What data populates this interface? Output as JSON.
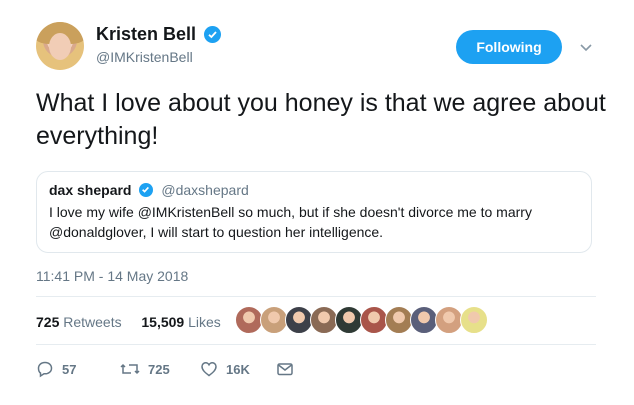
{
  "user": {
    "name": "Kristen Bell",
    "handle": "@IMKristenBell",
    "follow_label": "Following"
  },
  "tweet": {
    "text": "What I love about you honey is that we agree about everything!"
  },
  "quoted_tweet": {
    "name": "dax shepard",
    "handle": "@daxshepard",
    "text": "I love my wife @IMKristenBell so much, but if she doesn't divorce me to marry @donaldglover, I will start to question her intelligence."
  },
  "timestamp": "11:41 PM - 14 May 2018",
  "stats": {
    "retweets_count": "725",
    "retweets_label": "Retweets",
    "likes_count": "15,509",
    "likes_label": "Likes"
  },
  "actions": {
    "replies": "57",
    "retweets": "725",
    "likes": "16K"
  },
  "colors": {
    "accent": "#1da1f2",
    "muted": "#657786",
    "border": "#e1e8ed"
  },
  "liker_avatar_colors": [
    "#b06a5b",
    "#c9a07a",
    "#3d4049",
    "#8a6a55",
    "#2f3a35",
    "#a9554a",
    "#a37d54",
    "#5a5f7a",
    "#d3a07f",
    "#e7e08a"
  ]
}
